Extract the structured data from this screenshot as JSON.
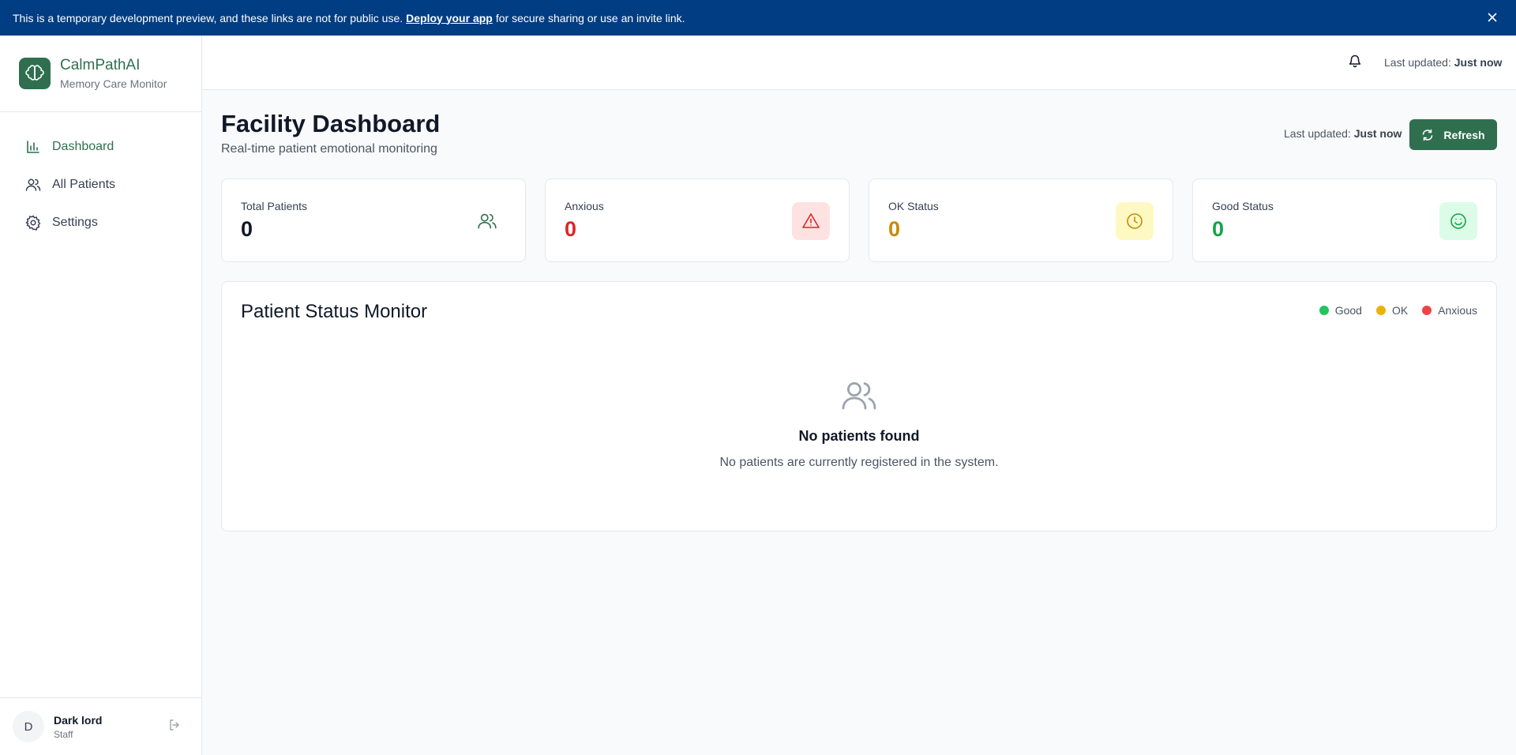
{
  "banner": {
    "prefix": "This is a temporary development preview, and these links are not for public use.",
    "link": "Deploy your app",
    "suffix": "for secure sharing or use an invite link."
  },
  "brand": {
    "name": "CalmPathAI",
    "subtitle": "Memory Care Monitor",
    "icon": "brain-icon"
  },
  "nav": {
    "items": [
      {
        "label": "Dashboard",
        "icon": "bar-chart-icon",
        "active": true
      },
      {
        "label": "All Patients",
        "icon": "users-icon",
        "active": false
      },
      {
        "label": "Settings",
        "icon": "gear-icon",
        "active": false
      }
    ]
  },
  "user": {
    "initial": "D",
    "name": "Dark lord",
    "role": "Staff"
  },
  "topbar": {
    "last_updated_label": "Last updated:",
    "last_updated_value": "Just now"
  },
  "page": {
    "title": "Facility Dashboard",
    "subtitle": "Real-time patient emotional monitoring",
    "last_updated_label": "Last updated:",
    "last_updated_value": "Just now",
    "refresh_label": "Refresh"
  },
  "stats": [
    {
      "label": "Total Patients",
      "value": "0",
      "color": "#111827",
      "icon": "users-icon",
      "icon_bg": "#ffffff",
      "icon_color": "#2f6f4f"
    },
    {
      "label": "Anxious",
      "value": "0",
      "color": "#dc2626",
      "icon": "alert-triangle-icon",
      "icon_bg": "#fee2e2",
      "icon_color": "#dc2626"
    },
    {
      "label": "OK Status",
      "value": "0",
      "color": "#ca8a04",
      "icon": "clock-icon",
      "icon_bg": "#fef9c3",
      "icon_color": "#ca8a04"
    },
    {
      "label": "Good Status",
      "value": "0",
      "color": "#16a34a",
      "icon": "smile-icon",
      "icon_bg": "#dcfce7",
      "icon_color": "#16a34a"
    }
  ],
  "monitor": {
    "title": "Patient Status Monitor",
    "legend": [
      {
        "label": "Good",
        "color": "#22c55e"
      },
      {
        "label": "OK",
        "color": "#eab308"
      },
      {
        "label": "Anxious",
        "color": "#ef4444"
      }
    ],
    "empty_title": "No patients found",
    "empty_text": "No patients are currently registered in the system."
  }
}
